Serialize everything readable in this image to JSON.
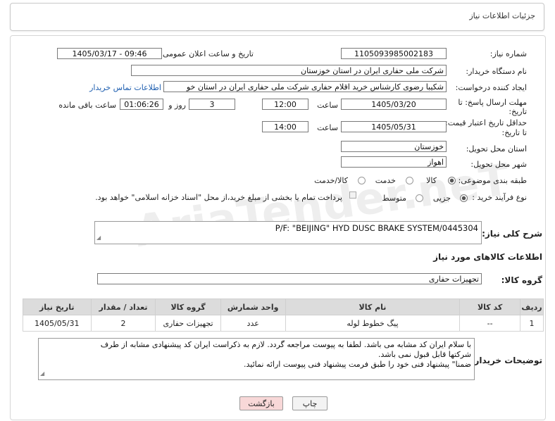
{
  "header": {
    "title": "جزئیات اطلاعات نیاز"
  },
  "form": {
    "need_number_label": "شماره نیاز:",
    "need_number": "1105093985002183",
    "announce_label": "تاریخ و ساعت اعلان عمومی:",
    "announce_value": "1405/03/17 - 09:46",
    "buyer_org_label": "نام دستگاه خریدار:",
    "buyer_org": "شرکت ملی حفاری ایران در استان خوزستان",
    "creator_label": "ایجاد کننده درخواست:",
    "creator": "شکیبا رضوی کارشناس خرید اقلام حفاری شرکت ملی حفاری ایران در استان خو",
    "contact_link": "اطلاعات تماس خریدار",
    "deadline_label_1": "مهلت ارسال پاسخ: تا",
    "deadline_label_2": "تاریخ:",
    "deadline_date": "1405/03/20",
    "time_label": "ساعت",
    "deadline_time": "12:00",
    "days_value": "3",
    "days_label": "روز و",
    "remaining_value": "01:06:26",
    "remaining_label": "ساعت باقی مانده",
    "validity_label_1": "حداقل تاریخ اعتبار قیمت:",
    "validity_label_2": "تا تاریخ:",
    "validity_date": "1405/05/31",
    "validity_time": "14:00",
    "province_label": "استان محل تحویل:",
    "province": "خوزستان",
    "city_label": "شهر محل تحویل:",
    "city": "اهواز",
    "category_label": "طبقه بندی موضوعی:",
    "category_options": [
      "کالا",
      "خدمت",
      "کالا/خدمت"
    ],
    "category_selected": "کالا",
    "process_label": "نوع فرآیند خرید :",
    "process_options": [
      "جزیی",
      "متوسط"
    ],
    "process_selected": "جزیی",
    "payment_note": "پرداخت تمام یا بخشی از مبلغ خرید،از محل \"اسناد خزانه اسلامی\" خواهد بود."
  },
  "description": {
    "label": "شرح کلی نیاز:",
    "value": "P/F: \"BEIJING\" HYD DUSC BRAKE  SYSTEM/0445304"
  },
  "goods": {
    "section_title": "اطلاعات کالاهای مورد نیاز",
    "group_label": "گروه کالا:",
    "group_value": "تجهیزات حفاری",
    "columns": [
      "ردیف",
      "کد کالا",
      "نام کالا",
      "واحد شمارش",
      "گروه کالا",
      "تعداد / مقدار",
      "تاریخ نیاز"
    ],
    "rows": [
      [
        "1",
        "--",
        "پیگ خطوط لوله",
        "عدد",
        "تجهیزات حفاری",
        "2",
        "1405/05/31"
      ]
    ]
  },
  "buyer_notes": {
    "label": "توضیحات خریدار:",
    "line1": "با سلام ایران کد مشابه می باشد. لطفا به پیوست مراجعه گردد. لازم به ذکراست ایران کد پیشنهادی مشابه از طرف",
    "line2": "شرکتها قابل قبول نمی باشد.",
    "line3": "ضمنا\" پیشنهاد فنی خود را طبق فرمت پیشنهاد فنی پیوست ارائه نمائید."
  },
  "buttons": {
    "print": "چاپ",
    "back": "بازگشت"
  },
  "watermark": "AriaTender.neT",
  "colors": {
    "link": "#1f5fb0",
    "back_button_bg": "#f8d8d8",
    "table_header_bg": "#dcdcdc"
  }
}
